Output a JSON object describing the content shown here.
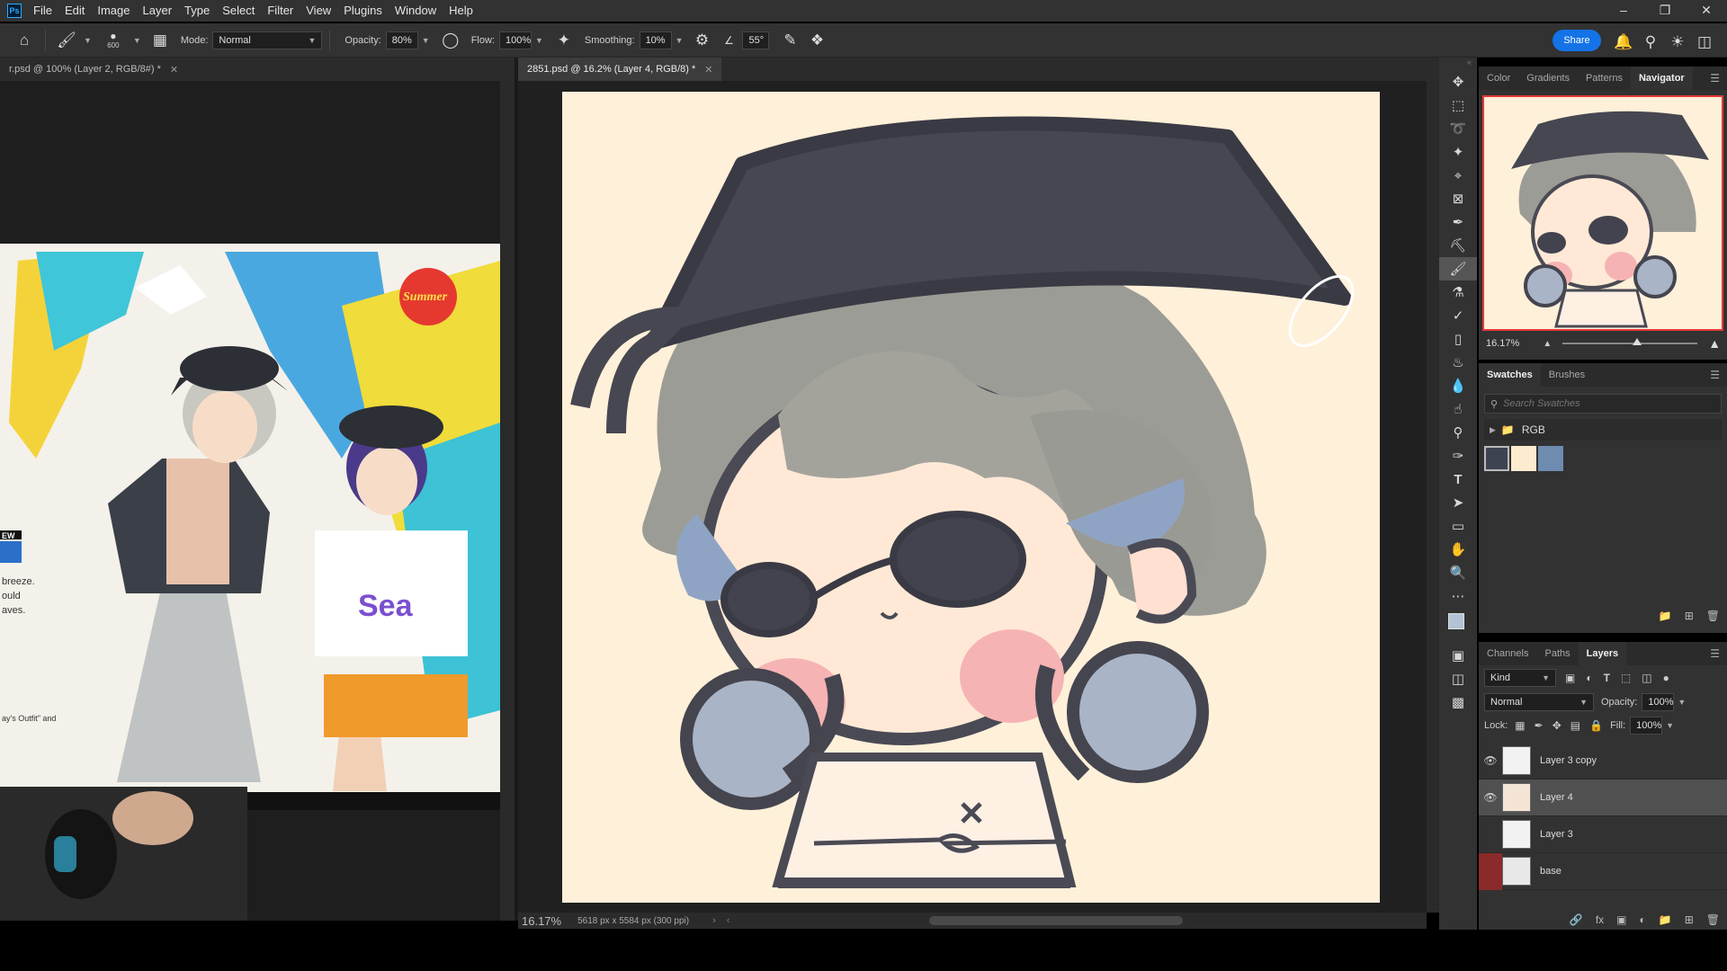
{
  "menubar": {
    "logo": "Ps",
    "items": [
      "File",
      "Edit",
      "Image",
      "Layer",
      "Type",
      "Select",
      "Filter",
      "View",
      "Plugins",
      "Window",
      "Help"
    ]
  },
  "options": {
    "brush_size": "600",
    "mode_label": "Mode:",
    "mode_value": "Normal",
    "opacity_label": "Opacity:",
    "opacity_value": "80%",
    "flow_label": "Flow:",
    "flow_value": "100%",
    "smoothing_label": "Smoothing:",
    "smoothing_value": "10%",
    "angle_value": "55°",
    "share_label": "Share"
  },
  "tabs": {
    "left": "r.psd @ 100% (Layer 2, RGB/8#) *",
    "main": "2851.psd @ 16.2% (Layer 4, RGB/8) *"
  },
  "reference": {
    "badge_text": "Summer",
    "sea_text": "Sea",
    "new_text": "EW",
    "left_text_lines": [
      "breeze.",
      "ould",
      "aves."
    ],
    "caption": "ay's Outfit\" and"
  },
  "status": {
    "zoom": "16.17%",
    "doc_info": "5618 px x 5584 px (300 ppi)"
  },
  "navigator": {
    "tabs": [
      "Color",
      "Gradients",
      "Patterns",
      "Navigator"
    ],
    "zoom": "16.17%",
    "zoom_level": 0.55
  },
  "swatches": {
    "tabs": [
      "Swatches",
      "Brushes"
    ],
    "search_placeholder": "Search Swatches",
    "group_name": "RGB",
    "colors": [
      "#3e4352",
      "#fdebd0",
      "#6e8bb0"
    ]
  },
  "layers_panel": {
    "tabs": [
      "Channels",
      "Paths",
      "Layers"
    ],
    "filter_kind": "Kind",
    "blend_mode": "Normal",
    "opacity_label": "Opacity:",
    "opacity_value": "100%",
    "lock_label": "Lock:",
    "fill_label": "Fill:",
    "fill_value": "100%",
    "layers": [
      {
        "name": "Layer 3 copy",
        "visible": true,
        "selected": false
      },
      {
        "name": "Layer 4",
        "visible": true,
        "selected": true
      },
      {
        "name": "Layer 3",
        "visible": false,
        "selected": false
      },
      {
        "name": "base",
        "visible": false,
        "selected": false
      }
    ]
  }
}
